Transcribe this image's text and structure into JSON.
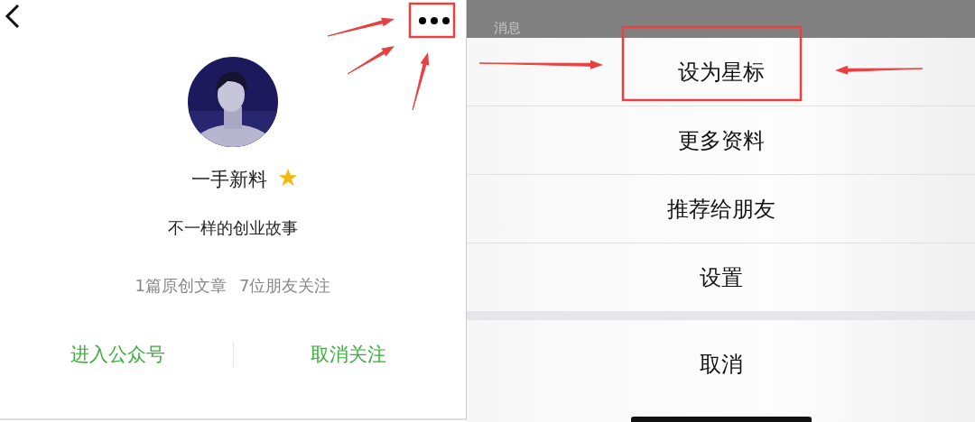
{
  "profile": {
    "name": "一手新料",
    "starred": true,
    "tagline": "不一样的创业故事",
    "stats": [
      "1篇原创文章",
      "7位朋友关注"
    ],
    "actions": [
      "进入公众号",
      "取消关注"
    ]
  },
  "background_text": "消息",
  "menu": {
    "items": [
      "设为星标",
      "更多资料",
      "推荐给朋友",
      "设置"
    ],
    "cancel": "取消"
  }
}
